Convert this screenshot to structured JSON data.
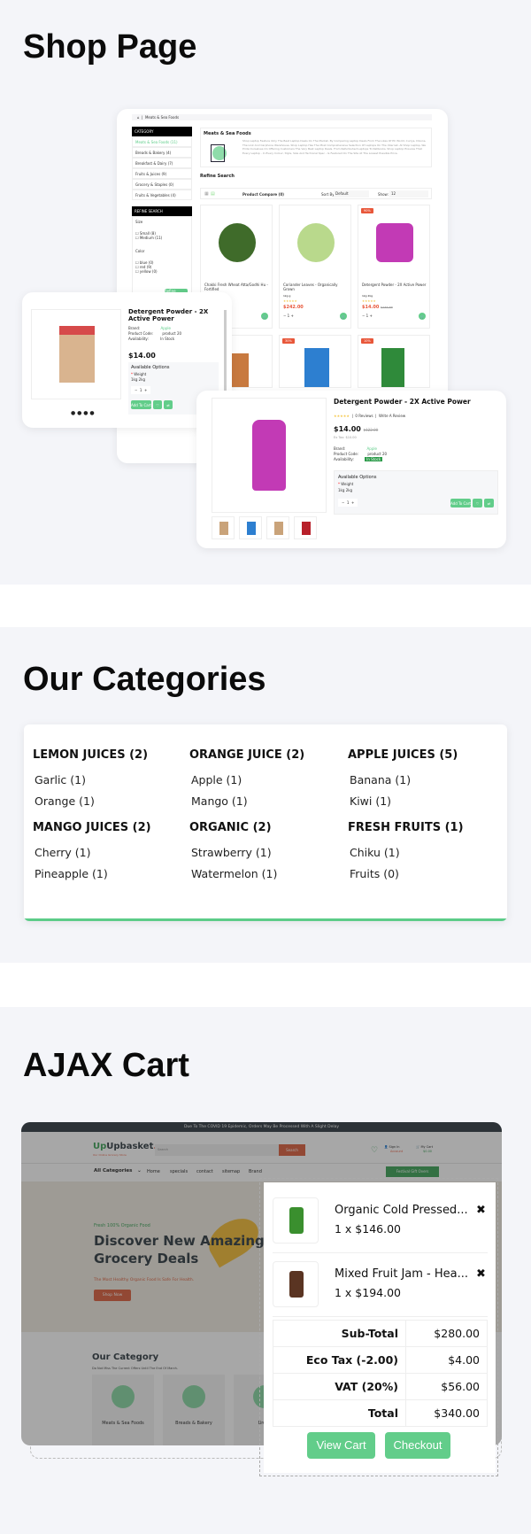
{
  "shop": {
    "title": "Shop Page",
    "breadcrumb": "Meats & Sea Foods",
    "category_header": "CATEGORY",
    "categories": [
      "Meats & Sea Foods (11)",
      "Breads & Bakery (4)",
      "Breakfast & Dairy (7)",
      "Fruits & Juices (9)",
      "Grocery & Staples (0)",
      "Fruits & Vegetables (4)"
    ],
    "refine_header": "REFINE SEARCH",
    "size_label": "Size",
    "sizes": [
      "Small (8)",
      "Medium (11)"
    ],
    "color_label": "Color",
    "colors": [
      "blue (0)",
      "red (9)",
      "yellow (0)"
    ],
    "refine_button": "Refine Search",
    "banner_title": "Meats & Sea Foods",
    "banner_text": "Shop Laptop Feature Only The Best Laptop Deals On The Market. By Comparing Laptop Deals From The Likes Of PC World, Currys, Dixons, The Link And Carphone Warehouse, Shop Laptop Has The Most Comprehensive Selection Of Laptops On The Internet. At Shop Laptop, We Pride Ourselves On Offering Customers The Very Best Laptop Deals. From Refurbished Laptops To Netbooks, Shop Laptop Ensures That Every Laptop - In Every Colour, Style, Size And Technical Spec - Is Featured On The Site At The Lowest Possible Price.",
    "refine_search": "Refine Search",
    "compare": "Product Compare (0)",
    "sort_label": "Sort By:",
    "sort_value": "Default",
    "show_label": "Show:",
    "show_value": "12",
    "products": [
      {
        "name": "Chakki Fresh Wheat Atta/Godhi Hu - Fortified",
        "price": "",
        "badge": ""
      },
      {
        "name": "Coriander Leaves - Organically Grown",
        "price": "$242.00",
        "weights": [
          "1kg",
          "g"
        ],
        "badge": ""
      },
      {
        "name": "Detergent Powder - 2X Active Power",
        "price": "$14.00",
        "old": "$122.00",
        "weights": [
          "1kg",
          "2kg"
        ],
        "badge": "90%"
      }
    ],
    "row2_badges": [
      "30%",
      "10%"
    ],
    "qty": "1"
  },
  "quick1": {
    "title": "Detergent Powder - 2X Active Power",
    "brand_label": "Brand:",
    "brand": "Apple",
    "code_label": "Product Code:",
    "code": "product 20",
    "avail_label": "Availability:",
    "avail": "In Stock",
    "price": "$14.00",
    "options": "Available Options",
    "weight": "Weight",
    "weights": "1kg 2kg",
    "qty": "1",
    "add": "Add To Cart"
  },
  "quick2": {
    "title": "Detergent Powder - 2X Active Power",
    "reviews": "0 Reviews",
    "write": "Write A Review",
    "price": "$14.00",
    "old": "$122.00",
    "extax": "Ex Tax: $10.00",
    "brand_label": "Brand:",
    "brand": "Apple",
    "code_label": "Product Code:",
    "code": "product 20",
    "avail_label": "Availability:",
    "avail": "In Stock",
    "options": "Available Options",
    "weight": "Weight",
    "w1": "1kg",
    "w2": "2kg",
    "qty": "1",
    "add": "Add To Cart"
  },
  "categories": {
    "title": "Our Categories",
    "accent": "#5ccc88",
    "groups": [
      {
        "heading": "LEMON JUICES (2)",
        "items": [
          "Garlic (1)",
          "Orange (1)"
        ]
      },
      {
        "heading": "ORANGE JUICE (2)",
        "items": [
          "Apple (1)",
          "Mango (1)"
        ]
      },
      {
        "heading": "APPLE JUICES (5)",
        "items": [
          "Banana (1)",
          "Kiwi (1)"
        ]
      },
      {
        "heading": "MANGO JUICES (2)",
        "items": [
          "Cherry (1)",
          "Pineapple (1)"
        ]
      },
      {
        "heading": "ORGANIC (2)",
        "items": [
          "Strawberry (1)",
          "Watermelon (1)"
        ]
      },
      {
        "heading": "FRESH FRUITS (1)",
        "items": [
          "Chiku (1)",
          "Fruits (0)"
        ]
      }
    ]
  },
  "ajax": {
    "title": "AJAX Cart",
    "topbar": "Due To The COVID 19 Epidemic, Orders May Be Processed With A Slight Delay",
    "logo": "Upbasket",
    "logo_dot": ".",
    "tagline": "Our Online Grocery Store",
    "search_placeholder": "Search",
    "search_button": "Search",
    "signin": "Sign In",
    "account": "Account",
    "mycart": "My Cart",
    "cart_total": "$0.00",
    "all_categories": "All Categories",
    "nav": [
      "Home",
      "specials",
      "contact",
      "sitemap",
      "Brand"
    ],
    "gift": "Festival Gift Overs",
    "hero_kicker": "Fresh 100% Organic Food",
    "hero_title1": "Discover New Amazing",
    "hero_title2": "Grocery Deals",
    "hero_sub": "The Most Healthy Organic Food Is Safe For Health.",
    "shop_now": "Shop Now",
    "cat_title": "Our Category",
    "cat_sub": "Do Not Miss The Current Offers Until The End Of March.",
    "cat_items": [
      "Meats & Sea Foods",
      "Breads & Bakery",
      "Break"
    ],
    "cart_items": [
      {
        "name": "Organic Cold Pressed...",
        "qty_price": "1 x $146.00"
      },
      {
        "name": "Mixed Fruit Jam - Hea...",
        "qty_price": "1 x $194.00"
      }
    ],
    "totals": [
      {
        "label": "Sub-Total",
        "value": "$280.00"
      },
      {
        "label": "Eco Tax (-2.00)",
        "value": "$4.00"
      },
      {
        "label": "VAT (20%)",
        "value": "$56.00"
      },
      {
        "label": "Total",
        "value": "$340.00"
      }
    ],
    "view_cart": "View Cart",
    "checkout": "Checkout"
  }
}
